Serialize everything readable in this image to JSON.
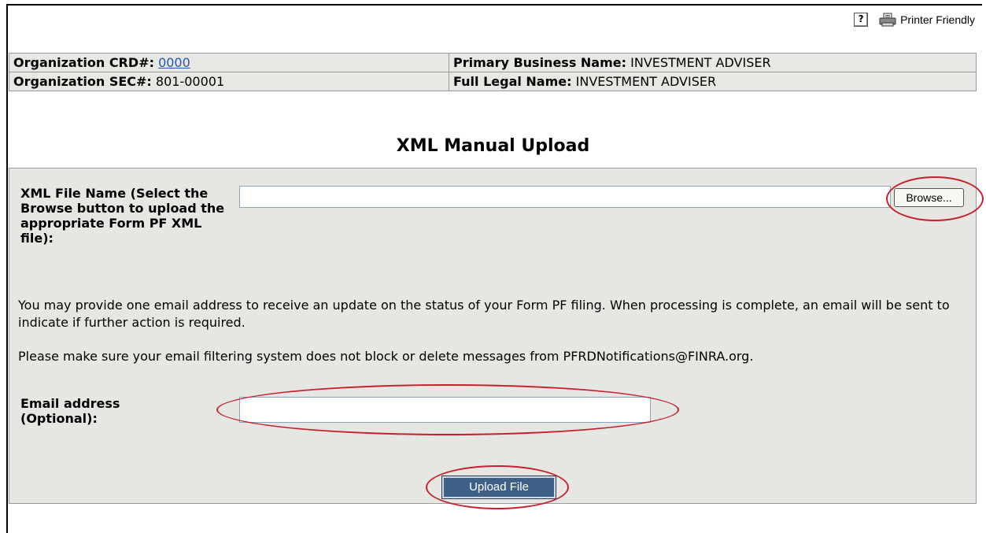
{
  "toolbar": {
    "help_label": "?",
    "help_icon": "help-icon",
    "printer_icon": "printer-icon",
    "printer_label": "Printer Friendly"
  },
  "organization": {
    "crd_label": "Organization CRD#:",
    "crd_value": "0000",
    "sec_label": "Organization SEC#:",
    "sec_value": "801-00001",
    "primary_name_label": "Primary Business Name:",
    "primary_name_value": "INVESTMENT ADVISER",
    "legal_name_label": "Full Legal Name:",
    "legal_name_value": "INVESTMENT ADVISER"
  },
  "page_title": "XML Manual Upload",
  "upload_form": {
    "file_label": "XML File Name (Select the Browse button to upload the appropriate Form PF XML file):",
    "file_value": "",
    "browse_label": "Browse...",
    "email_info": "You may provide one email address to receive an update on the status of your Form PF filing. When processing is complete, an email will be sent to indicate if further action is required.",
    "filter_info": "Please make sure your email filtering system does not block or delete messages from PFRDNotifications@FINRA.org.",
    "email_label": "Email address (Optional):",
    "email_value": "",
    "upload_label": "Upload File"
  },
  "colors": {
    "highlight": "#c6202c",
    "upload_button": "#3e5f86",
    "panel_background": "#e6e6e2",
    "link": "#2056b5"
  }
}
